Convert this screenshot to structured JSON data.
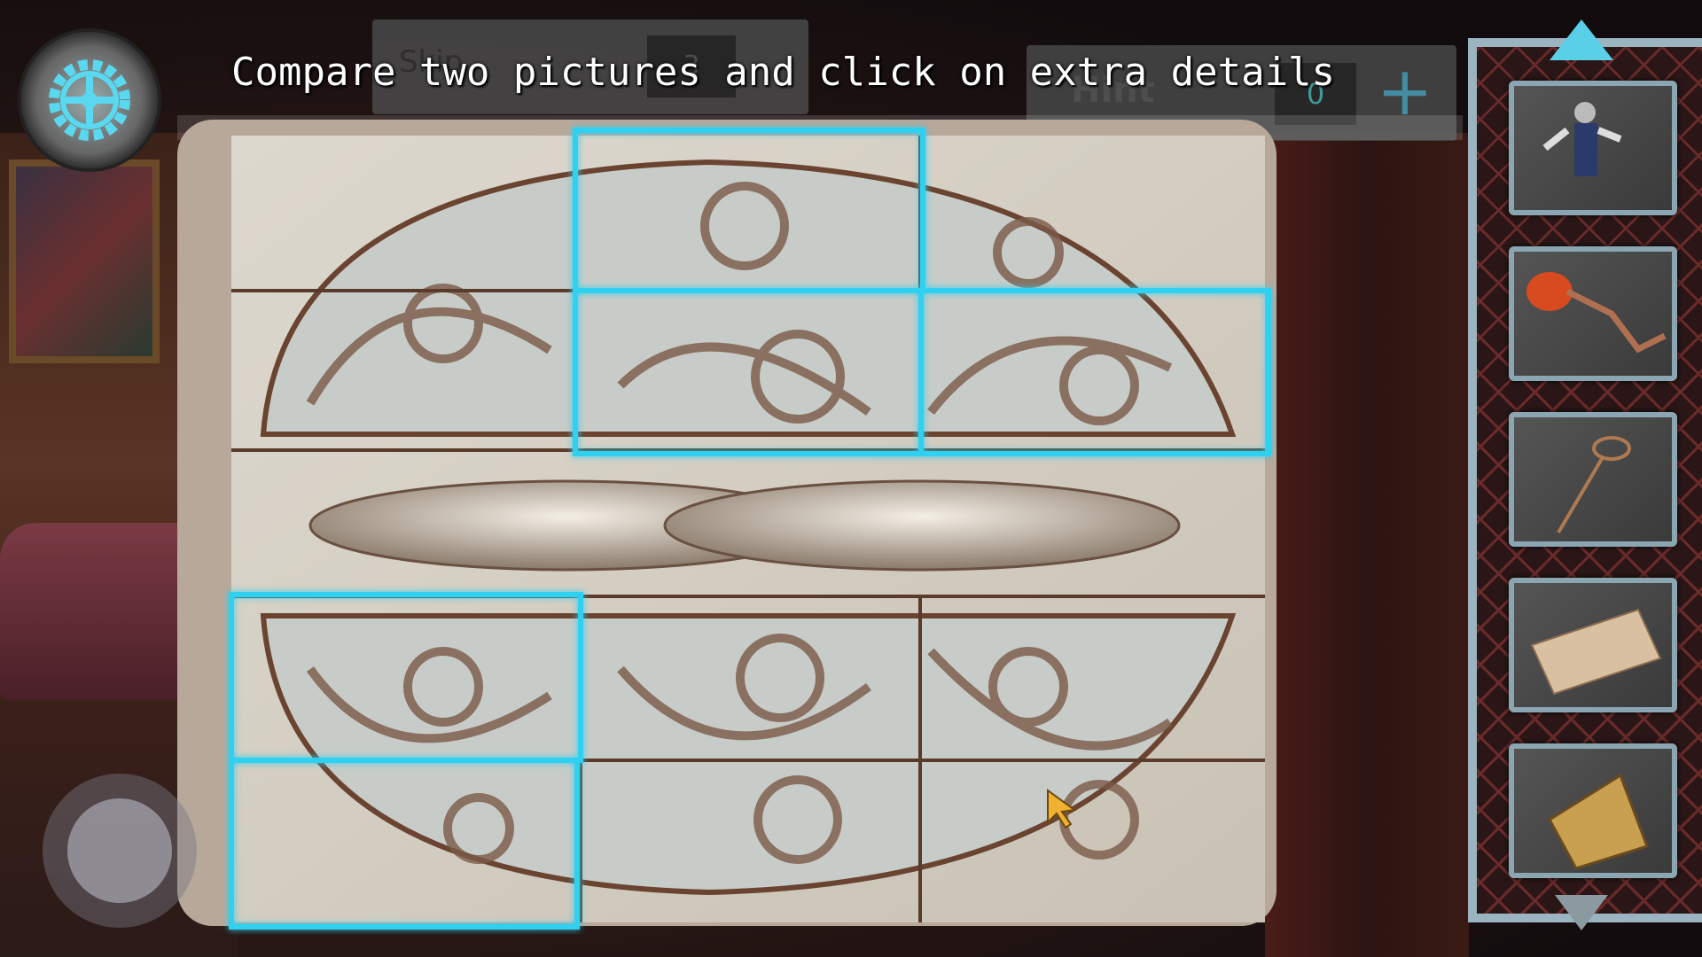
{
  "hud": {
    "instruction": "Compare two pictures and click on extra details",
    "skip_label": "Skip",
    "skip_count": "3",
    "hint_label": "Hint",
    "hint_count": "0",
    "hint_add": "+",
    "settings_icon": "gear-icon"
  },
  "puzzle": {
    "found_differences": 5,
    "highlight_color": "#2fd0f0"
  },
  "inventory": {
    "items": [
      {
        "name": "ragdoll"
      },
      {
        "name": "crank-handle"
      },
      {
        "name": "wire-loop"
      },
      {
        "name": "paper-ticket"
      },
      {
        "name": "old-book"
      }
    ]
  }
}
